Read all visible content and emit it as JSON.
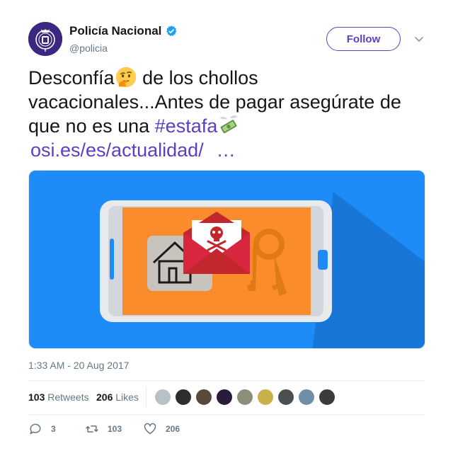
{
  "author": {
    "display_name": "Policía Nacional",
    "handle": "@policia",
    "verified_icon": "verified-badge-icon"
  },
  "follow_label": "Follow",
  "tweet": {
    "line1_a": "Desconfía",
    "line1_b": " de los chollos",
    "line2": "vacacionales...Antes de pagar asegúrate de",
    "line3_a": "que no es una ",
    "hashtag": "#estafa",
    "link": "osi.es/es/actualidad/",
    "ellipsis": "…"
  },
  "timestamp": "1:33 AM - 20 Aug 2017",
  "stats": {
    "retweets_count": "103",
    "retweets_label": "Retweets",
    "likes_count": "206",
    "likes_label": "Likes"
  },
  "actions": {
    "reply_count": "3",
    "retweet_count": "103",
    "like_count": "206"
  },
  "colors": {
    "accent": "#5b3fc4",
    "media_bg": "#1d8cf8",
    "screen_orange": "#fb8c2b"
  }
}
